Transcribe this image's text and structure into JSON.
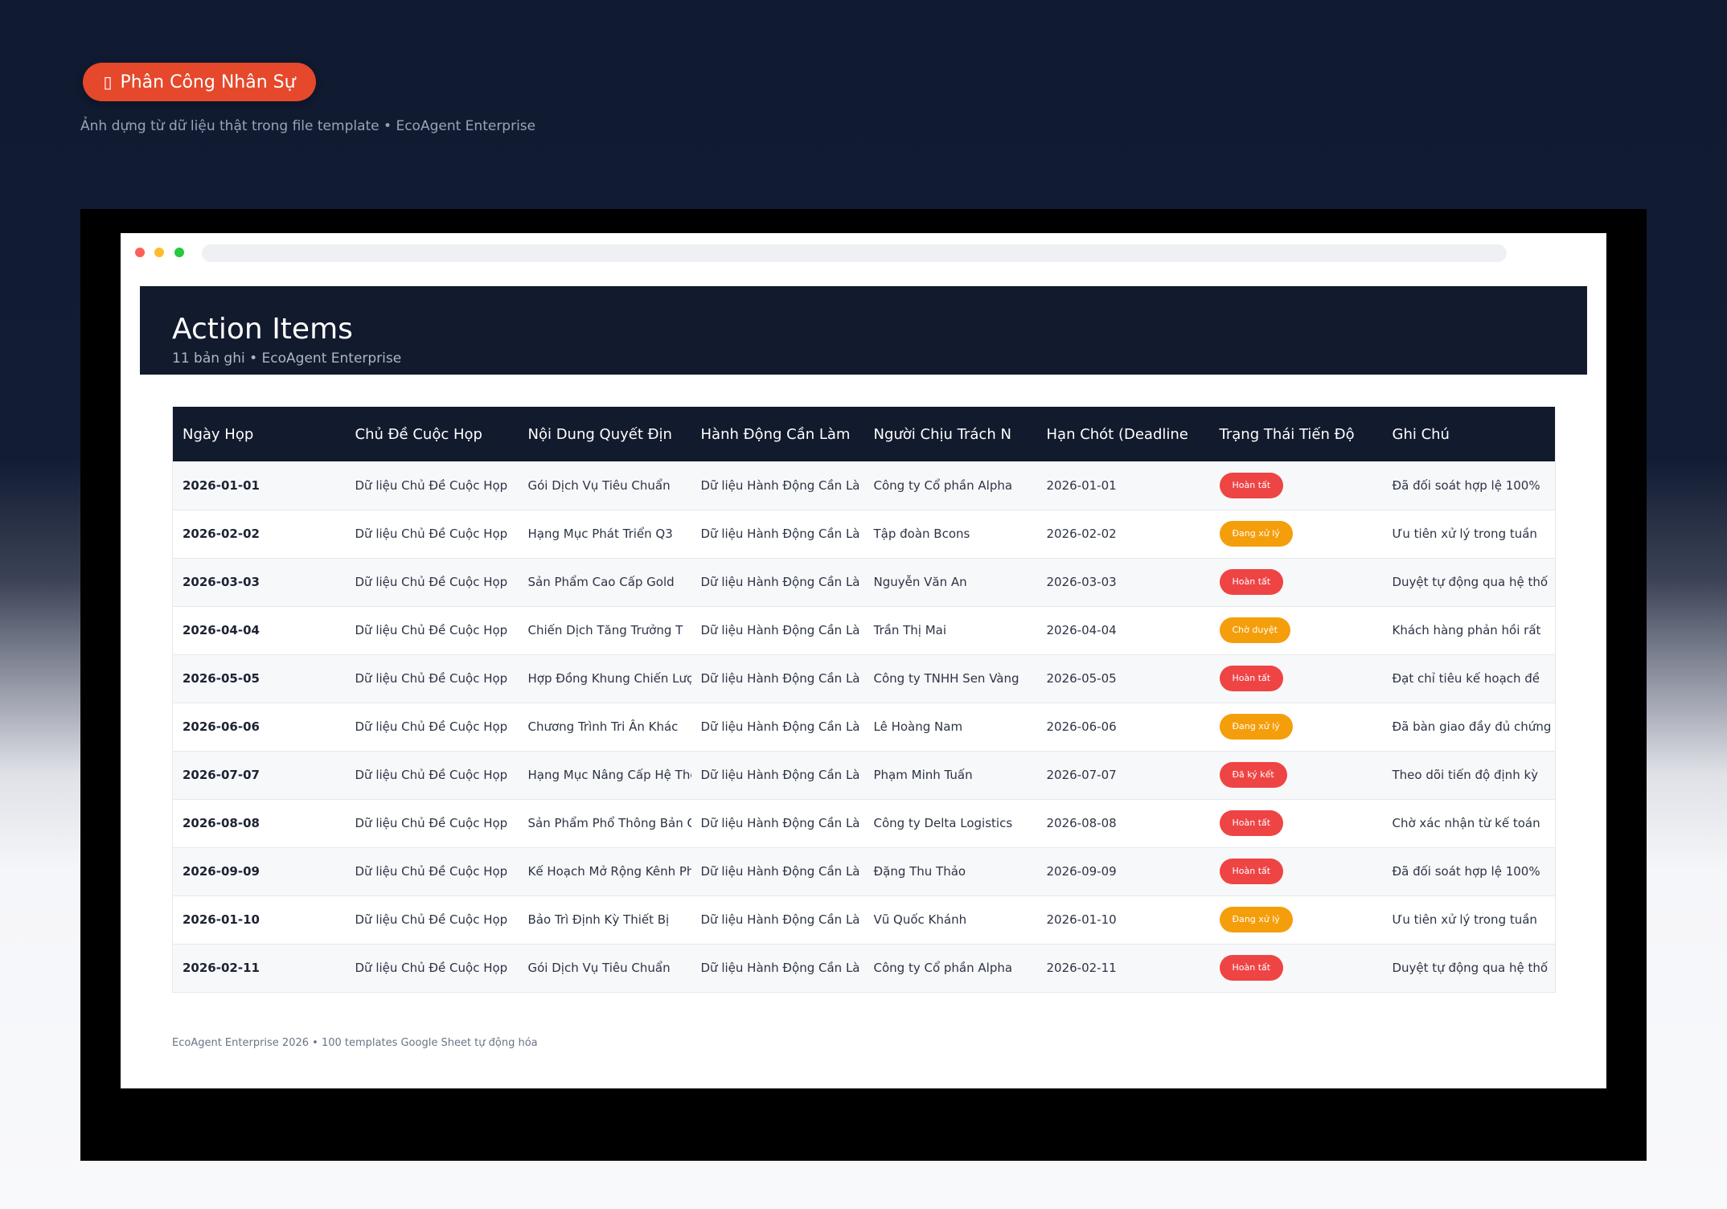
{
  "badge": {
    "icon": "clipboard-icon",
    "icon_glyph": "▯",
    "label": "Phân Công Nhân Sự"
  },
  "subtitle": "Ảnh dựng từ dữ liệu thật trong file template • EcoAgent Enterprise",
  "header": {
    "title": "Action Items",
    "subtitle": "11 bản ghi • EcoAgent Enterprise"
  },
  "table": {
    "columns": [
      "Ngày Họp",
      "Chủ Đề Cuộc Họp",
      "Nội Dung Quyết Địn",
      "Hành Động Cần Làm",
      "Người Chịu Trách N",
      "Hạn Chót (Deadline",
      "Trạng Thái Tiến Độ",
      "Ghi Chú"
    ],
    "rows": [
      {
        "date": "2026-01-01",
        "topic": "Dữ liệu Chủ Đề Cuộc Họp",
        "decision": "Gói Dịch Vụ Tiêu Chuẩn",
        "action": "Dữ liệu Hành Động Cần Là",
        "owner": "Công ty Cổ phần Alpha",
        "deadline": "2026-01-01",
        "status": "Hoàn tất",
        "status_color": "#ef4444",
        "note": "Đã đối soát hợp lệ 100%"
      },
      {
        "date": "2026-02-02",
        "topic": "Dữ liệu Chủ Đề Cuộc Họp",
        "decision": "Hạng Mục Phát Triển Q3",
        "action": "Dữ liệu Hành Động Cần Là",
        "owner": "Tập đoàn Bcons",
        "deadline": "2026-02-02",
        "status": "Đang xử lý",
        "status_color": "#f59e0b",
        "note": "Ưu tiên xử lý trong tuần"
      },
      {
        "date": "2026-03-03",
        "topic": "Dữ liệu Chủ Đề Cuộc Họp",
        "decision": "Sản Phẩm Cao Cấp Gold",
        "action": "Dữ liệu Hành Động Cần Là",
        "owner": "Nguyễn Văn An",
        "deadline": "2026-03-03",
        "status": "Hoàn tất",
        "status_color": "#ef4444",
        "note": "Duyệt tự động qua hệ thố"
      },
      {
        "date": "2026-04-04",
        "topic": "Dữ liệu Chủ Đề Cuộc Họp",
        "decision": "Chiến Dịch Tăng Trưởng T",
        "action": "Dữ liệu Hành Động Cần Là",
        "owner": "Trần Thị Mai",
        "deadline": "2026-04-04",
        "status": "Chờ duyệt",
        "status_color": "#f59e0b",
        "note": "Khách hàng phản hồi rất"
      },
      {
        "date": "2026-05-05",
        "topic": "Dữ liệu Chủ Đề Cuộc Họp",
        "decision": "Hợp Đồng Khung Chiến Lượ",
        "action": "Dữ liệu Hành Động Cần Là",
        "owner": "Công ty TNHH Sen Vàng",
        "deadline": "2026-05-05",
        "status": "Hoàn tất",
        "status_color": "#ef4444",
        "note": "Đạt chỉ tiêu kế hoạch đề"
      },
      {
        "date": "2026-06-06",
        "topic": "Dữ liệu Chủ Đề Cuộc Họp",
        "decision": "Chương Trình Tri Ân Khác",
        "action": "Dữ liệu Hành Động Cần Là",
        "owner": "Lê Hoàng Nam",
        "deadline": "2026-06-06",
        "status": "Đang xử lý",
        "status_color": "#f59e0b",
        "note": "Đã bàn giao đầy đủ chứng"
      },
      {
        "date": "2026-07-07",
        "topic": "Dữ liệu Chủ Đề Cuộc Họp",
        "decision": "Hạng Mục Nâng Cấp Hệ Thố",
        "action": "Dữ liệu Hành Động Cần Là",
        "owner": "Phạm Minh Tuấn",
        "deadline": "2026-07-07",
        "status": "Đã ký kết",
        "status_color": "#ef4444",
        "note": "Theo dõi tiến độ định kỳ"
      },
      {
        "date": "2026-08-08",
        "topic": "Dữ liệu Chủ Đề Cuộc Họp",
        "decision": "Sản Phẩm Phổ Thông Bản C",
        "action": "Dữ liệu Hành Động Cần Là",
        "owner": "Công ty Delta Logistics",
        "deadline": "2026-08-08",
        "status": "Hoàn tất",
        "status_color": "#ef4444",
        "note": "Chờ xác nhận từ kế toán"
      },
      {
        "date": "2026-09-09",
        "topic": "Dữ liệu Chủ Đề Cuộc Họp",
        "decision": "Kế Hoạch Mở Rộng Kênh Ph",
        "action": "Dữ liệu Hành Động Cần Là",
        "owner": "Đặng Thu Thảo",
        "deadline": "2026-09-09",
        "status": "Hoàn tất",
        "status_color": "#ef4444",
        "note": "Đã đối soát hợp lệ 100%"
      },
      {
        "date": "2026-01-10",
        "topic": "Dữ liệu Chủ Đề Cuộc Họp",
        "decision": "Bảo Trì Định Kỳ Thiết Bị",
        "action": "Dữ liệu Hành Động Cần Là",
        "owner": "Vũ Quốc Khánh",
        "deadline": "2026-01-10",
        "status": "Đang xử lý",
        "status_color": "#f59e0b",
        "note": "Ưu tiên xử lý trong tuần"
      },
      {
        "date": "2026-02-11",
        "topic": "Dữ liệu Chủ Đề Cuộc Họp",
        "decision": "Gói Dịch Vụ Tiêu Chuẩn",
        "action": "Dữ liệu Hành Động Cần Là",
        "owner": "Công ty Cổ phần Alpha",
        "deadline": "2026-02-11",
        "status": "Hoàn tất",
        "status_color": "#ef4444",
        "note": "Duyệt tự động qua hệ thố"
      }
    ]
  },
  "footer": "EcoAgent Enterprise 2026 • 100 templates Google Sheet tự động hóa",
  "colors": {
    "accent": "#e5482b",
    "navy": "#121a2d",
    "status_red": "#ef4444",
    "status_orange": "#f59e0b"
  }
}
